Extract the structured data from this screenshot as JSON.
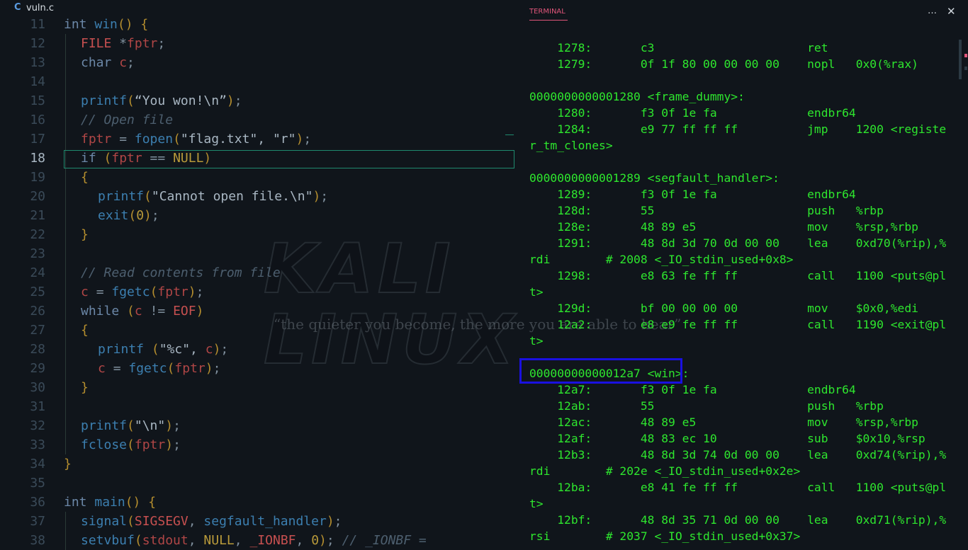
{
  "wallpaper": {
    "title": "KALI LINUX",
    "tagline": "“the quieter you become, the more you are able to hear”"
  },
  "editor": {
    "tab": {
      "icon": "c-language-icon",
      "icon_text": "C",
      "label": "vuln.c"
    },
    "active_line": 18,
    "lines": [
      {
        "num": "11",
        "indent": 0,
        "tokens": [
          [
            "k",
            "int "
          ],
          [
            "f",
            "win"
          ],
          [
            "p",
            "() {"
          ]
        ]
      },
      {
        "num": "12",
        "indent": 1,
        "tokens": [
          [
            "t",
            "FILE "
          ],
          [
            "o",
            "*"
          ],
          [
            "v",
            "fptr"
          ],
          [
            "o",
            ";"
          ]
        ]
      },
      {
        "num": "13",
        "indent": 1,
        "tokens": [
          [
            "k",
            "char "
          ],
          [
            "v",
            "c"
          ],
          [
            "o",
            ";"
          ]
        ]
      },
      {
        "num": "14",
        "indent": 1,
        "tokens": []
      },
      {
        "num": "15",
        "indent": 1,
        "tokens": [
          [
            "f",
            "printf"
          ],
          [
            "p",
            "("
          ],
          [
            "s",
            "“You won!\\n”"
          ],
          [
            "p",
            ")"
          ],
          [
            "o",
            ";"
          ]
        ]
      },
      {
        "num": "16",
        "indent": 1,
        "tokens": [
          [
            "c",
            "// Open file"
          ]
        ]
      },
      {
        "num": "17",
        "indent": 1,
        "tokens": [
          [
            "v",
            "fptr "
          ],
          [
            "o",
            "= "
          ],
          [
            "f",
            "fopen"
          ],
          [
            "p",
            "("
          ],
          [
            "s",
            "\"flag.txt\", \"r\""
          ],
          [
            "p",
            ")"
          ],
          [
            "o",
            ";"
          ]
        ]
      },
      {
        "num": "18",
        "indent": 1,
        "tokens": [
          [
            "k",
            "if "
          ],
          [
            "p",
            "("
          ],
          [
            "v",
            "fptr "
          ],
          [
            "o",
            "== "
          ],
          [
            "n",
            "NULL"
          ],
          [
            "p",
            ")"
          ]
        ]
      },
      {
        "num": "19",
        "indent": 1,
        "tokens": [
          [
            "p",
            "{"
          ]
        ]
      },
      {
        "num": "20",
        "indent": 2,
        "tokens": [
          [
            "f",
            "printf"
          ],
          [
            "p",
            "("
          ],
          [
            "s",
            "\"Cannot open file.\\n\""
          ],
          [
            "p",
            ")"
          ],
          [
            "o",
            ";"
          ]
        ]
      },
      {
        "num": "21",
        "indent": 2,
        "tokens": [
          [
            "f",
            "exit"
          ],
          [
            "p",
            "("
          ],
          [
            "n",
            "0"
          ],
          [
            "p",
            ")"
          ],
          [
            "o",
            ";"
          ]
        ]
      },
      {
        "num": "22",
        "indent": 1,
        "tokens": [
          [
            "p",
            "}"
          ]
        ]
      },
      {
        "num": "23",
        "indent": 1,
        "tokens": []
      },
      {
        "num": "24",
        "indent": 1,
        "tokens": [
          [
            "c",
            "// Read contents from file"
          ]
        ]
      },
      {
        "num": "25",
        "indent": 1,
        "tokens": [
          [
            "v",
            "c "
          ],
          [
            "o",
            "= "
          ],
          [
            "f",
            "fgetc"
          ],
          [
            "p",
            "("
          ],
          [
            "v",
            "fptr"
          ],
          [
            "p",
            ")"
          ],
          [
            "o",
            ";"
          ]
        ]
      },
      {
        "num": "26",
        "indent": 1,
        "tokens": [
          [
            "k",
            "while "
          ],
          [
            "p",
            "("
          ],
          [
            "v",
            "c "
          ],
          [
            "o",
            "!= "
          ],
          [
            "t",
            "EOF"
          ],
          [
            "p",
            ")"
          ]
        ]
      },
      {
        "num": "27",
        "indent": 1,
        "tokens": [
          [
            "p",
            "{"
          ]
        ]
      },
      {
        "num": "28",
        "indent": 2,
        "tokens": [
          [
            "f",
            "printf "
          ],
          [
            "p",
            "("
          ],
          [
            "s",
            "\"%c\", "
          ],
          [
            "v",
            "c"
          ],
          [
            "p",
            ")"
          ],
          [
            "o",
            ";"
          ]
        ]
      },
      {
        "num": "29",
        "indent": 2,
        "tokens": [
          [
            "v",
            "c "
          ],
          [
            "o",
            "= "
          ],
          [
            "f",
            "fgetc"
          ],
          [
            "p",
            "("
          ],
          [
            "v",
            "fptr"
          ],
          [
            "p",
            ")"
          ],
          [
            "o",
            ";"
          ]
        ]
      },
      {
        "num": "30",
        "indent": 1,
        "tokens": [
          [
            "p",
            "}"
          ]
        ]
      },
      {
        "num": "31",
        "indent": 1,
        "tokens": []
      },
      {
        "num": "32",
        "indent": 1,
        "tokens": [
          [
            "f",
            "printf"
          ],
          [
            "p",
            "("
          ],
          [
            "s",
            "\"\\n\""
          ],
          [
            "p",
            ")"
          ],
          [
            "o",
            ";"
          ]
        ]
      },
      {
        "num": "33",
        "indent": 1,
        "tokens": [
          [
            "f",
            "fclose"
          ],
          [
            "p",
            "("
          ],
          [
            "v",
            "fptr"
          ],
          [
            "p",
            ")"
          ],
          [
            "o",
            ";"
          ]
        ]
      },
      {
        "num": "34",
        "indent": 0,
        "tokens": [
          [
            "p",
            "}"
          ]
        ]
      },
      {
        "num": "35",
        "indent": 0,
        "tokens": []
      },
      {
        "num": "36",
        "indent": 0,
        "tokens": [
          [
            "k",
            "int "
          ],
          [
            "f",
            "main"
          ],
          [
            "p",
            "() {"
          ]
        ]
      },
      {
        "num": "37",
        "indent": 1,
        "tokens": [
          [
            "f",
            "signal"
          ],
          [
            "p",
            "("
          ],
          [
            "t",
            "SIGSEGV"
          ],
          [
            "o",
            ", "
          ],
          [
            "f",
            "segfault_handler"
          ],
          [
            "p",
            ")"
          ],
          [
            "o",
            ";"
          ]
        ]
      },
      {
        "num": "38",
        "indent": 1,
        "tokens": [
          [
            "f",
            "setvbuf"
          ],
          [
            "p",
            "("
          ],
          [
            "v",
            "stdout"
          ],
          [
            "o",
            ", "
          ],
          [
            "n",
            "NULL"
          ],
          [
            "o",
            ", "
          ],
          [
            "t",
            "_IONBF"
          ],
          [
            "o",
            ", "
          ],
          [
            "n",
            "0"
          ],
          [
            "p",
            ")"
          ],
          [
            "o",
            "; "
          ],
          [
            "c",
            "// _IONBF ="
          ]
        ]
      }
    ]
  },
  "terminal": {
    "tab_label": "TERMINAL",
    "more_icon": "…",
    "close_icon": "✕",
    "lines": [
      "    1278:       c3                      ret",
      "    1279:       0f 1f 80 00 00 00 00    nopl   0x0(%rax)",
      "",
      "0000000000001280 <frame_dummy>:",
      "    1280:       f3 0f 1e fa             endbr64",
      "    1284:       e9 77 ff ff ff          jmp    1200 <registe",
      "r_tm_clones>",
      "",
      "0000000000001289 <segfault_handler>:",
      "    1289:       f3 0f 1e fa             endbr64",
      "    128d:       55                      push   %rbp",
      "    128e:       48 89 e5                mov    %rsp,%rbp",
      "    1291:       48 8d 3d 70 0d 00 00    lea    0xd70(%rip),%",
      "rdi        # 2008 <_IO_stdin_used+0x8>",
      "    1298:       e8 63 fe ff ff          call   1100 <puts@pl",
      "t>",
      "    129d:       bf 00 00 00 00          mov    $0x0,%edi",
      "    12a2:       e8 e9 fe ff ff          call   1190 <exit@pl",
      "t>",
      "",
      "00000000000012a7 <win>:",
      "    12a7:       f3 0f 1e fa             endbr64",
      "    12ab:       55                      push   %rbp",
      "    12ac:       48 89 e5                mov    %rsp,%rbp",
      "    12af:       48 83 ec 10             sub    $0x10,%rsp",
      "    12b3:       48 8d 3d 74 0d 00 00    lea    0xd74(%rip),%",
      "rdi        # 202e <_IO_stdin_used+0x2e>",
      "    12ba:       e8 41 fe ff ff          call   1100 <puts@pl",
      "t>",
      "    12bf:       48 8d 35 71 0d 00 00    lea    0xd71(%rip),%",
      "rsi        # 2037 <_IO_stdin_used+0x37>"
    ]
  }
}
